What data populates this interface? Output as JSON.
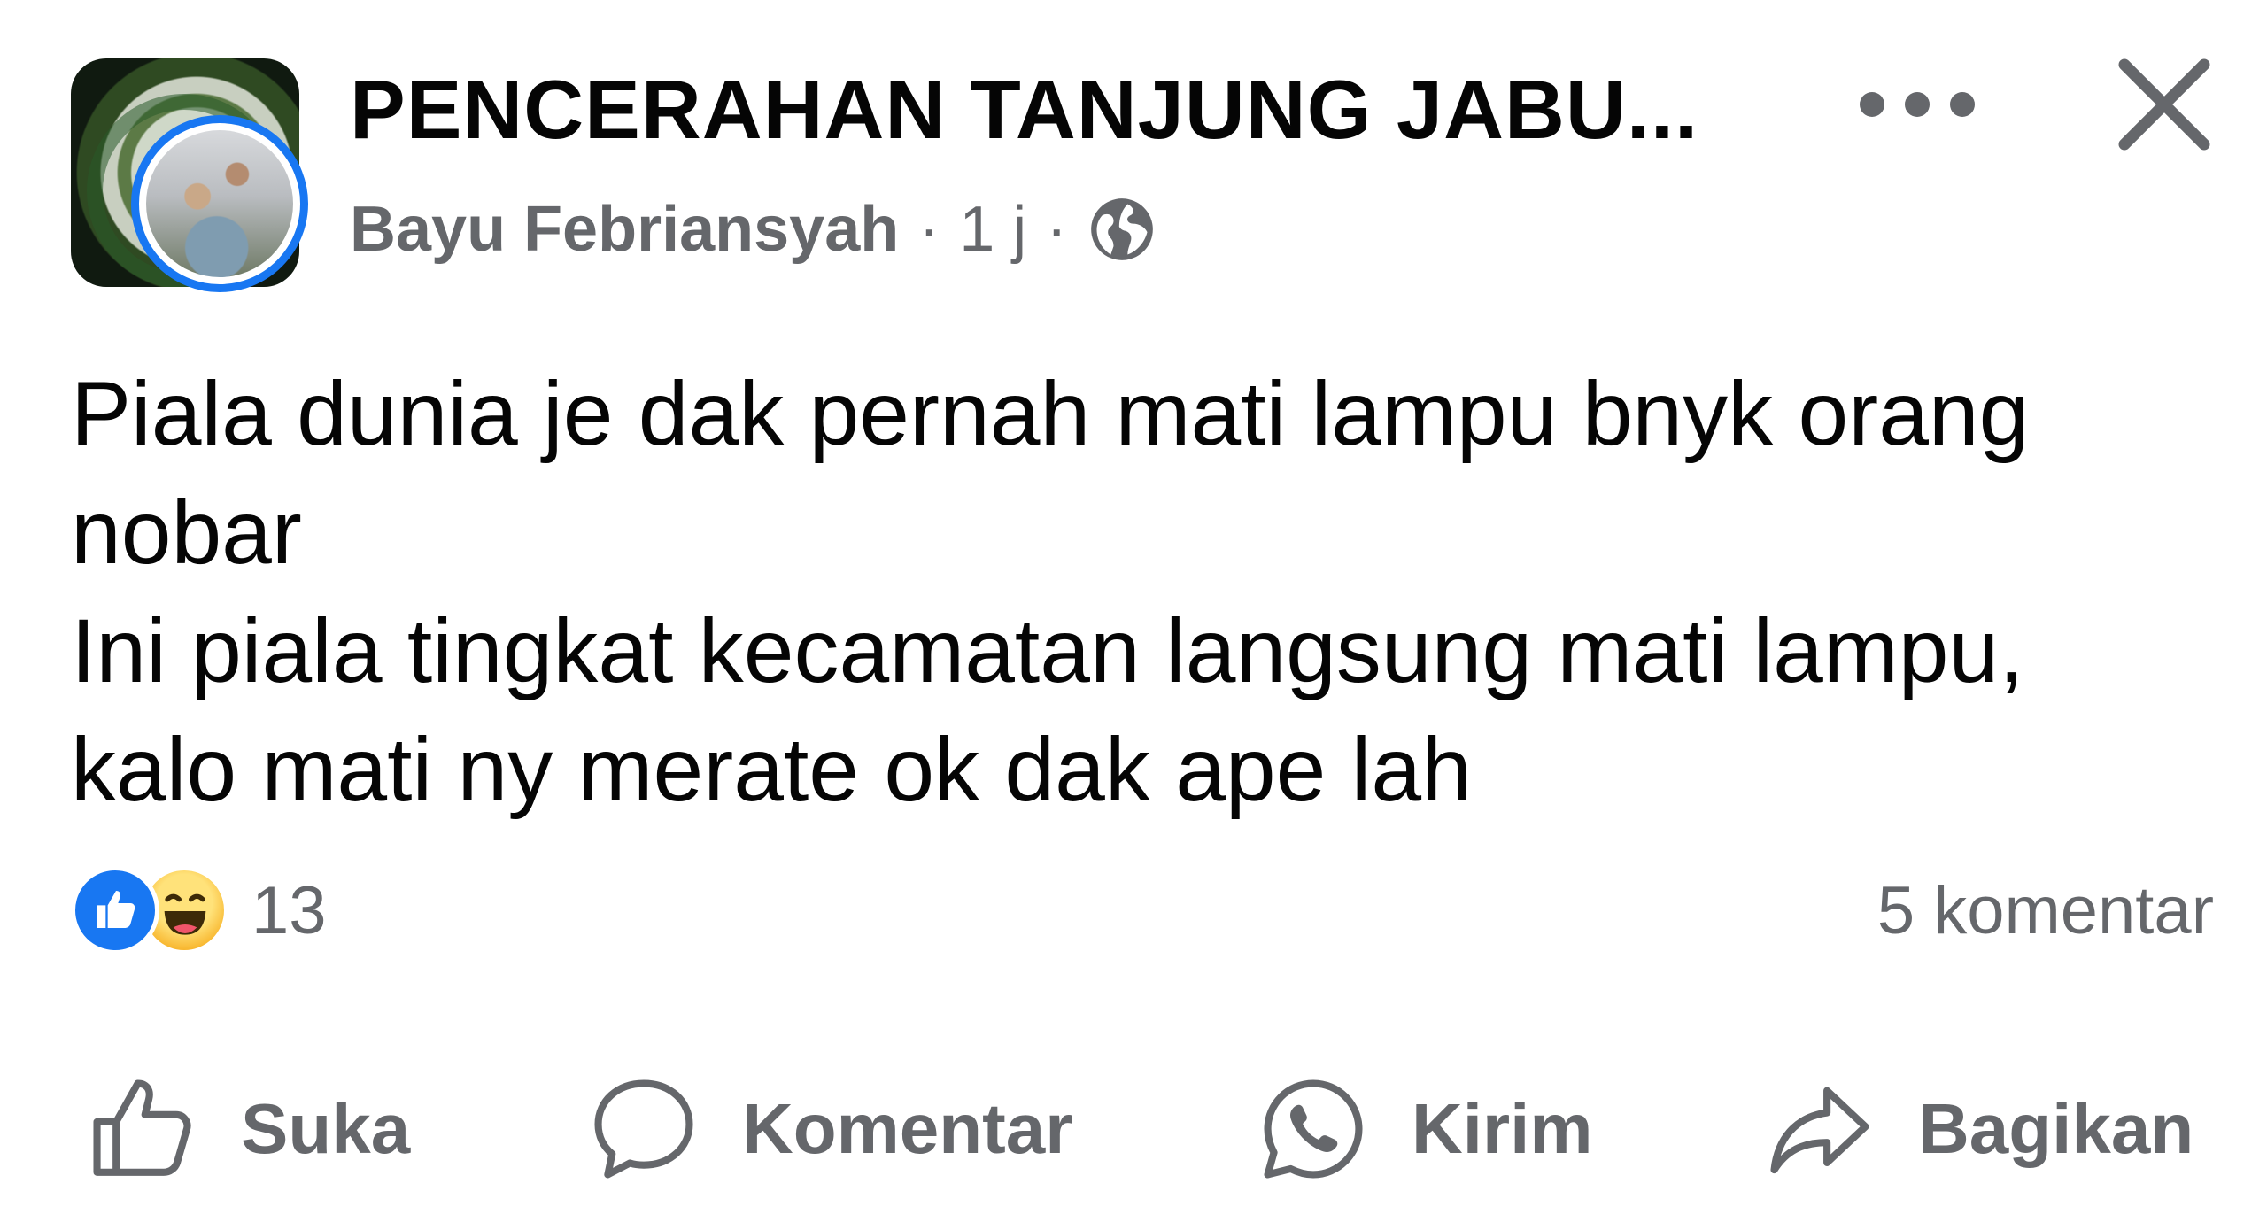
{
  "header": {
    "group_name": "PENCERAHAN TANJUNG JABU...",
    "author": "Bayu Febriansyah",
    "separator": "·",
    "time": "1 j",
    "privacy_icon": "globe-icon",
    "more_icon": "more-dots-icon",
    "close_icon": "close-icon"
  },
  "post": {
    "lines": [
      "Piala dunia je dak pernah mati lampu bnyk orang",
      "nobar",
      "Ini piala tingkat kecamatan langsung mati lampu,",
      "kalo mati ny merate ok dak ape lah"
    ]
  },
  "stats": {
    "reaction_icons": [
      "like-reaction-icon",
      "haha-reaction-icon"
    ],
    "reaction_count": "13",
    "comments": "5 komentar"
  },
  "actions": [
    {
      "label": "Suka",
      "icon": "thumbs-up-icon"
    },
    {
      "label": "Komentar",
      "icon": "comment-icon"
    },
    {
      "label": "Kirim",
      "icon": "whatsapp-icon"
    },
    {
      "label": "Bagikan",
      "icon": "share-icon"
    }
  ],
  "colors": {
    "accent": "#1877f2",
    "text": "#050505",
    "secondary_text": "#65676b",
    "haha": "#f7b125"
  }
}
